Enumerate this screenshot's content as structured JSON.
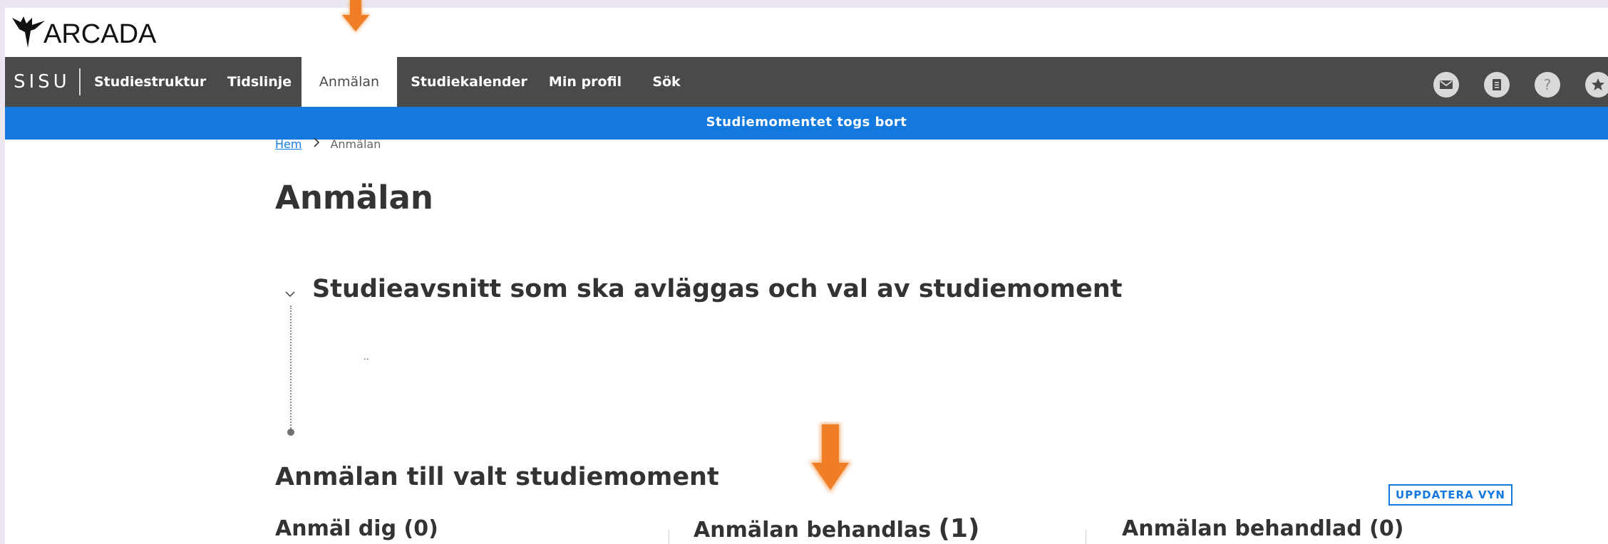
{
  "logo": {
    "text": "ARCADA",
    "icon": "bird-logo-icon"
  },
  "navbar": {
    "brand": "SISU",
    "items": [
      {
        "label": "Studiestruktur",
        "active": false
      },
      {
        "label": "Tidslinje",
        "active": false
      },
      {
        "label": "Anmälan",
        "active": true
      },
      {
        "label": "Studiekalender",
        "active": false
      },
      {
        "label": "Min profil",
        "active": false
      },
      {
        "label": "Sök",
        "active": false
      }
    ],
    "icons": [
      "mail-icon",
      "document-icon",
      "help-icon",
      "star-icon"
    ],
    "help_glyph": "?"
  },
  "notification": {
    "text": "Studiemomentet togs bort"
  },
  "breadcrumb": {
    "home": "Hem",
    "current": "Anmälan"
  },
  "page": {
    "title": "Anmälan",
    "section_title": "Studieavsnitt som ska avläggas och val av studiemoment",
    "section_placeholder": "..",
    "registration_title": "Anmälan till valt studiemoment",
    "refresh_button": "UPPDATERA VYN",
    "columns": [
      {
        "label": "Anmäl dig",
        "count": "(0)"
      },
      {
        "label": "Anmälan behandlas",
        "count": "(1)"
      },
      {
        "label": "Anmälan behandlad",
        "count": "(0)"
      }
    ]
  },
  "colors": {
    "navbar": "#4a4a4a",
    "notification": "#1479de",
    "accent_arrow": "#f07e26",
    "link": "#1479de"
  }
}
